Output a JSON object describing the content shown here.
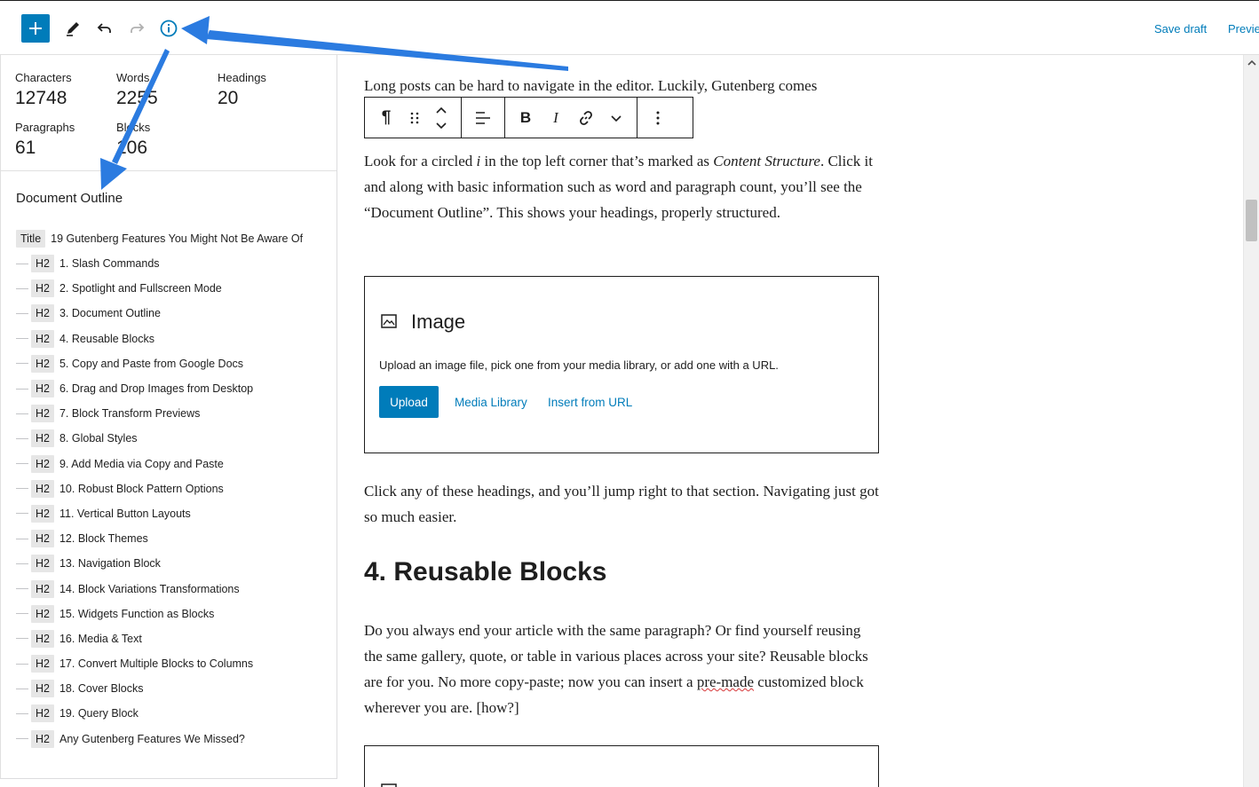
{
  "topbar": {
    "add_icon": "plus-icon",
    "tools": [
      "pencil-icon",
      "undo-icon",
      "redo-icon",
      "info-icon"
    ],
    "save_draft": "Save draft",
    "preview": "Previe"
  },
  "stats": {
    "characters_label": "Characters",
    "characters_value": "12748",
    "words_label": "Words",
    "words_value": "2255",
    "headings_label": "Headings",
    "headings_value": "20",
    "paragraphs_label": "Paragraphs",
    "paragraphs_value": "61",
    "blocks_label": "Blocks",
    "blocks_value": "106"
  },
  "outline": {
    "title": "Document Outline",
    "title_level": "Title",
    "post_title": "19 Gutenberg Features You Might Not Be Aware Of",
    "items": [
      {
        "level": "H2",
        "text": "1. Slash Commands"
      },
      {
        "level": "H2",
        "text": "2. Spotlight and Fullscreen Mode"
      },
      {
        "level": "H2",
        "text": "3. Document Outline"
      },
      {
        "level": "H2",
        "text": "4. Reusable Blocks"
      },
      {
        "level": "H2",
        "text": "5. Copy and Paste from Google Docs"
      },
      {
        "level": "H2",
        "text": "6. Drag and Drop Images from Desktop"
      },
      {
        "level": "H2",
        "text": "7. Block Transform Previews"
      },
      {
        "level": "H2",
        "text": "8. Global Styles"
      },
      {
        "level": "H2",
        "text": "9. Add Media via Copy and Paste"
      },
      {
        "level": "H2",
        "text": "10. Robust Block Pattern Options"
      },
      {
        "level": "H2",
        "text": "11. Vertical Button Layouts"
      },
      {
        "level": "H2",
        "text": "12. Block Themes"
      },
      {
        "level": "H2",
        "text": "13. Navigation Block"
      },
      {
        "level": "H2",
        "text": "14. Block Variations Transformations"
      },
      {
        "level": "H2",
        "text": "15. Widgets Function as Blocks"
      },
      {
        "level": "H2",
        "text": "16. Media & Text"
      },
      {
        "level": "H2",
        "text": "17. Convert Multiple Blocks to Columns"
      },
      {
        "level": "H2",
        "text": "18. Cover Blocks"
      },
      {
        "level": "H2",
        "text": "19. Query Block"
      },
      {
        "level": "H2",
        "text": "Any Gutenberg Features We Missed?"
      }
    ]
  },
  "editor": {
    "para1": "Long posts can be hard to navigate in the editor. Luckily, Gutenberg comes",
    "para2_a": "Look for a circled ",
    "para2_i": "i",
    "para2_b": " in the top left corner that’s marked as ",
    "para2_em": "Content Structure",
    "para2_c": ". Click it and along with basic information such as word and paragraph count, you’ll see the “Document Outline”. This shows your headings, properly structured.",
    "image_title": "Image",
    "image_desc": "Upload an image file, pick one from your media library, or add one with a URL.",
    "upload_label": "Upload",
    "media_library_label": "Media Library",
    "insert_url_label": "Insert from URL",
    "para3": "Click any of these headings, and you’ll jump right to that section. Navigating just got so much easier.",
    "heading": "4. Reusable Blocks",
    "para4_a": "Do you always end your article with the same paragraph? Or find yourself reusing the same gallery, quote, or table in various places across your site? Reusable blocks are for you. No more copy-paste; now you can insert a ",
    "para4_sp1": "pre-made",
    "para4_b": " customized block wherever you are. [how?]"
  },
  "block_toolbar": {
    "icons": [
      "paragraph-icon",
      "drag-handle-icon",
      "move-updown-icon",
      "align-icon",
      "bold-icon",
      "italic-icon",
      "link-icon",
      "more-chevron-icon",
      "options-icon"
    ]
  },
  "colors": {
    "accent": "#007cba",
    "arrow": "#2b7be0"
  }
}
